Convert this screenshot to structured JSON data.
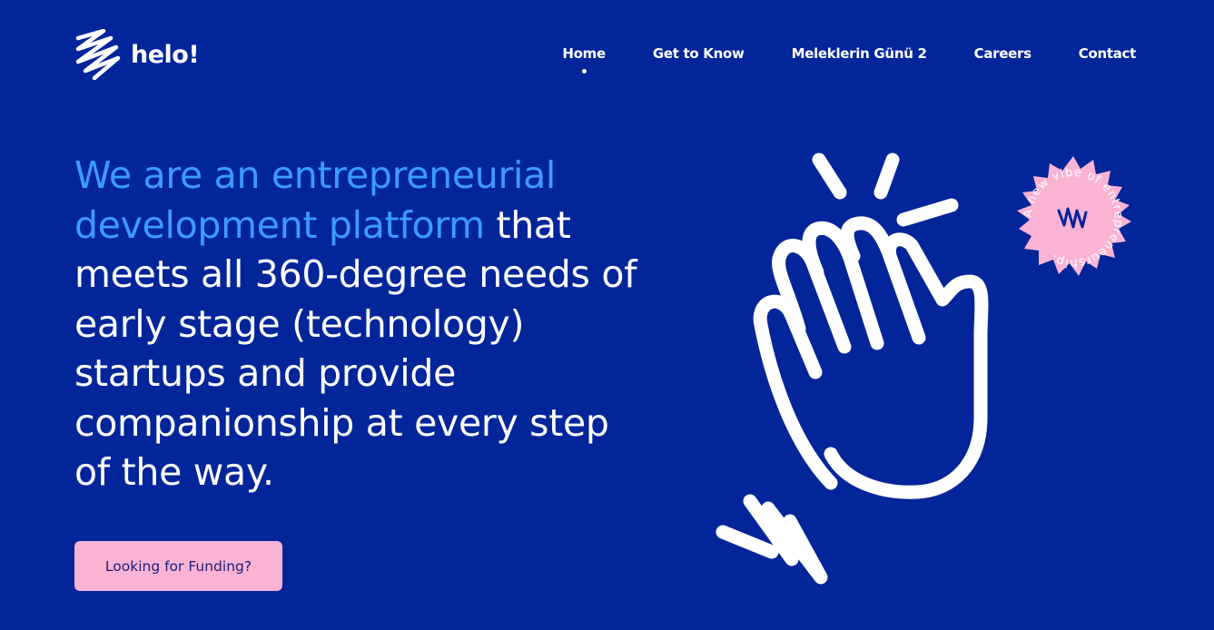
{
  "brand": {
    "name": "helo!",
    "logo_icon": "scribble-logo-icon"
  },
  "nav": {
    "items": [
      {
        "label": "Home",
        "active": true
      },
      {
        "label": "Get to Know"
      },
      {
        "label": "Meleklerin Günü 2"
      },
      {
        "label": "Careers"
      },
      {
        "label": "Contact"
      }
    ]
  },
  "hero": {
    "lines": [
      {
        "accent": "We are an entrepreneurial",
        "rest": ""
      },
      {
        "accent": "development platform",
        "rest": " that"
      },
      {
        "accent": "",
        "rest": "meets all 360-degree needs of"
      },
      {
        "accent": "",
        "rest": "early stage (technology)"
      },
      {
        "accent": "",
        "rest": "startups and provide"
      },
      {
        "accent": "",
        "rest": "companionship at every step"
      },
      {
        "accent": "",
        "rest": "of the way."
      }
    ],
    "cta_label": "Looking for Funding?"
  },
  "illustration": {
    "hand_icon": "waving-hand-icon",
    "badge_text": "A new vibe of entrepreneurship."
  },
  "colors": {
    "background": "#03259a",
    "accent": "#3d9bff",
    "badge": "#fbb3d4",
    "button": "#fbb3d4",
    "button_text": "#1a1f7a"
  }
}
